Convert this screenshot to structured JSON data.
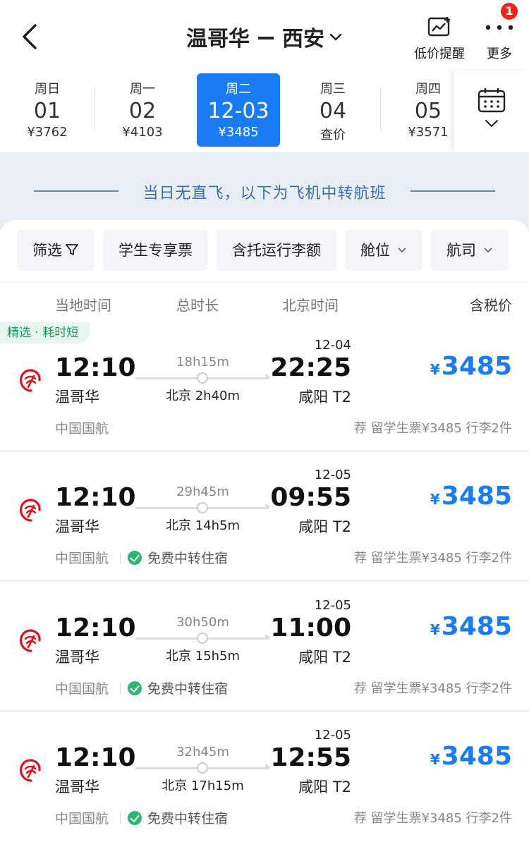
{
  "header": {
    "origin": "温哥华",
    "destination": "西安",
    "alert_label": "低价提醒",
    "more_label": "更多",
    "more_badge": "1"
  },
  "dates": [
    {
      "weekday": "周日",
      "day": "01",
      "price": "¥3762",
      "selected": false
    },
    {
      "weekday": "周一",
      "day": "02",
      "price": "¥4103",
      "selected": false
    },
    {
      "weekday": "周二",
      "day": "12-03",
      "price": "¥3485",
      "selected": true
    },
    {
      "weekday": "周三",
      "day": "04",
      "price": "查价",
      "selected": false
    },
    {
      "weekday": "周四",
      "day": "05",
      "price": "¥3571",
      "selected": false
    }
  ],
  "notice": "当日无直飞，以下为飞机中转航班",
  "filters": [
    "筛选",
    "学生专享票",
    "含托运行李额",
    "舱位",
    "航司"
  ],
  "columns": {
    "local_time": "当地时间",
    "duration": "总时长",
    "beijing_time": "北京时间",
    "price": "含税价"
  },
  "flights": [
    {
      "tag": "精选 · 耗时短",
      "dep_time": "12:10",
      "dep_city": "温哥华",
      "duration": "18h15m",
      "stop": "北京 2h40m",
      "arr_date": "12-04",
      "arr_time": "22:25",
      "arr_airport": "咸阳 T2",
      "currency": "¥",
      "price": "3485",
      "airline": "中国国航",
      "perk": "",
      "recommend": "荐 留学生票¥3485 行李2件"
    },
    {
      "tag": "",
      "dep_time": "12:10",
      "dep_city": "温哥华",
      "duration": "29h45m",
      "stop": "北京 14h5m",
      "arr_date": "12-05",
      "arr_time": "09:55",
      "arr_airport": "咸阳 T2",
      "currency": "¥",
      "price": "3485",
      "airline": "中国国航",
      "perk": "免费中转住宿",
      "recommend": "荐 留学生票¥3485 行李2件"
    },
    {
      "tag": "",
      "dep_time": "12:10",
      "dep_city": "温哥华",
      "duration": "30h50m",
      "stop": "北京 15h5m",
      "arr_date": "12-05",
      "arr_time": "11:00",
      "arr_airport": "咸阳 T2",
      "currency": "¥",
      "price": "3485",
      "airline": "中国国航",
      "perk": "免费中转住宿",
      "recommend": "荐 留学生票¥3485 行李2件"
    },
    {
      "tag": "",
      "dep_time": "12:10",
      "dep_city": "温哥华",
      "duration": "32h45m",
      "stop": "北京 17h15m",
      "arr_date": "12-05",
      "arr_time": "12:55",
      "arr_airport": "咸阳 T2",
      "currency": "¥",
      "price": "3485",
      "airline": "中国国航",
      "perk": "免费中转住宿",
      "recommend": "荐 留学生票¥3485 行李2件"
    }
  ],
  "colors": {
    "accent": "#1a7cf2",
    "badge": "#e8271d",
    "notice_text": "#3f6fa8",
    "logo_red": "#d7151d"
  },
  "icons": {
    "back": "chevron-left-icon",
    "alert": "price-alert-chart-icon",
    "more": "ellipsis-icon",
    "calendar": "calendar-icon",
    "airline_logo": "air-china-logo"
  }
}
